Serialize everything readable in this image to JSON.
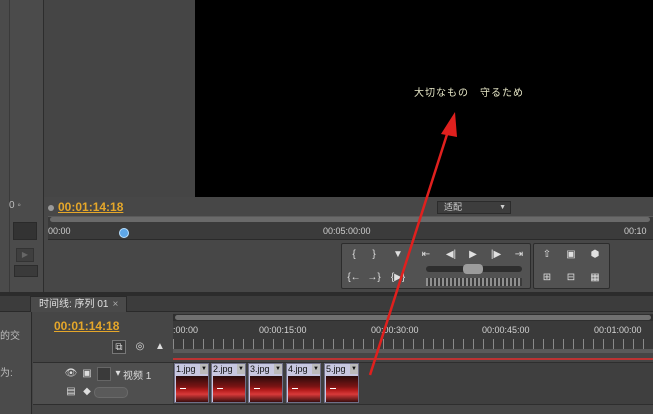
{
  "program_monitor": {
    "subtitle": "大切なもの　守るため",
    "timecode": "00:01:14:18",
    "fit": "适配",
    "ruler": [
      "00:00",
      "00:05:00:00",
      "00:10"
    ],
    "left_timecode": "0 ◦"
  },
  "timeline": {
    "tab_label": "时间线: 序列 01",
    "tab_close": "×",
    "timecode": "00:01:14:18",
    "ruler": [
      ":00:00",
      "00:00:15:00",
      "00:00:30:00",
      "00:00:45:00",
      "00:01:00:00"
    ],
    "track_name": "视频 1",
    "clips": [
      "1.jpg",
      "2.jpg",
      "3.jpg",
      "4.jpg",
      "5.jpg"
    ],
    "left_frag_1": "的交",
    "left_frag_2": "为:"
  },
  "colors": {
    "timecode": "#e5a72a",
    "arrow": "#e0201e",
    "clip": "#c7c7e0"
  },
  "icons": [
    "eye-icon",
    "film-icon",
    "snap-icon",
    "marker-icon",
    "play-icon",
    "step-back-icon",
    "step-forward-icon",
    "lift-icon",
    "extract-icon",
    "export-frame-icon"
  ]
}
